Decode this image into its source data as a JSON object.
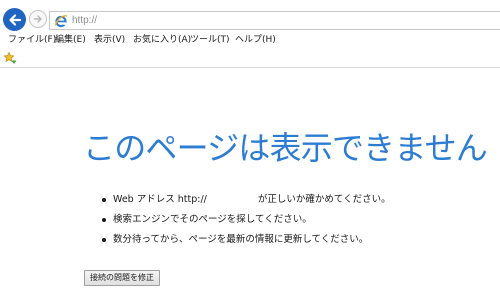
{
  "toolbar": {
    "address_text": "http://",
    "back_icon": "back-arrow-icon",
    "forward_icon": "forward-arrow-icon",
    "page_icon": "ie-logo-icon"
  },
  "menu": {
    "items": [
      {
        "label": "ファイル(F)"
      },
      {
        "label": "編集(E)"
      },
      {
        "label": "表示(V)"
      },
      {
        "label": "お気に入り(A)"
      },
      {
        "label": "ツール(T)"
      },
      {
        "label": "ヘルプ(H)"
      }
    ]
  },
  "favorites": {
    "icon": "favorites-star-icon"
  },
  "error_page": {
    "title": "このページは表示できません",
    "bullets": {
      "web_address_prefix": "Web アドレス http://",
      "web_address_suffix": "が正しいか確かめてください。",
      "search": "検索エンジンでそのページを探してください。",
      "wait": "数分待ってから、ページを最新の情報に更新してください。"
    },
    "fix_button_label": "接続の問題を修正"
  },
  "colors": {
    "title_blue": "#2c7cd4",
    "back_button_blue": "#1f65c1"
  }
}
